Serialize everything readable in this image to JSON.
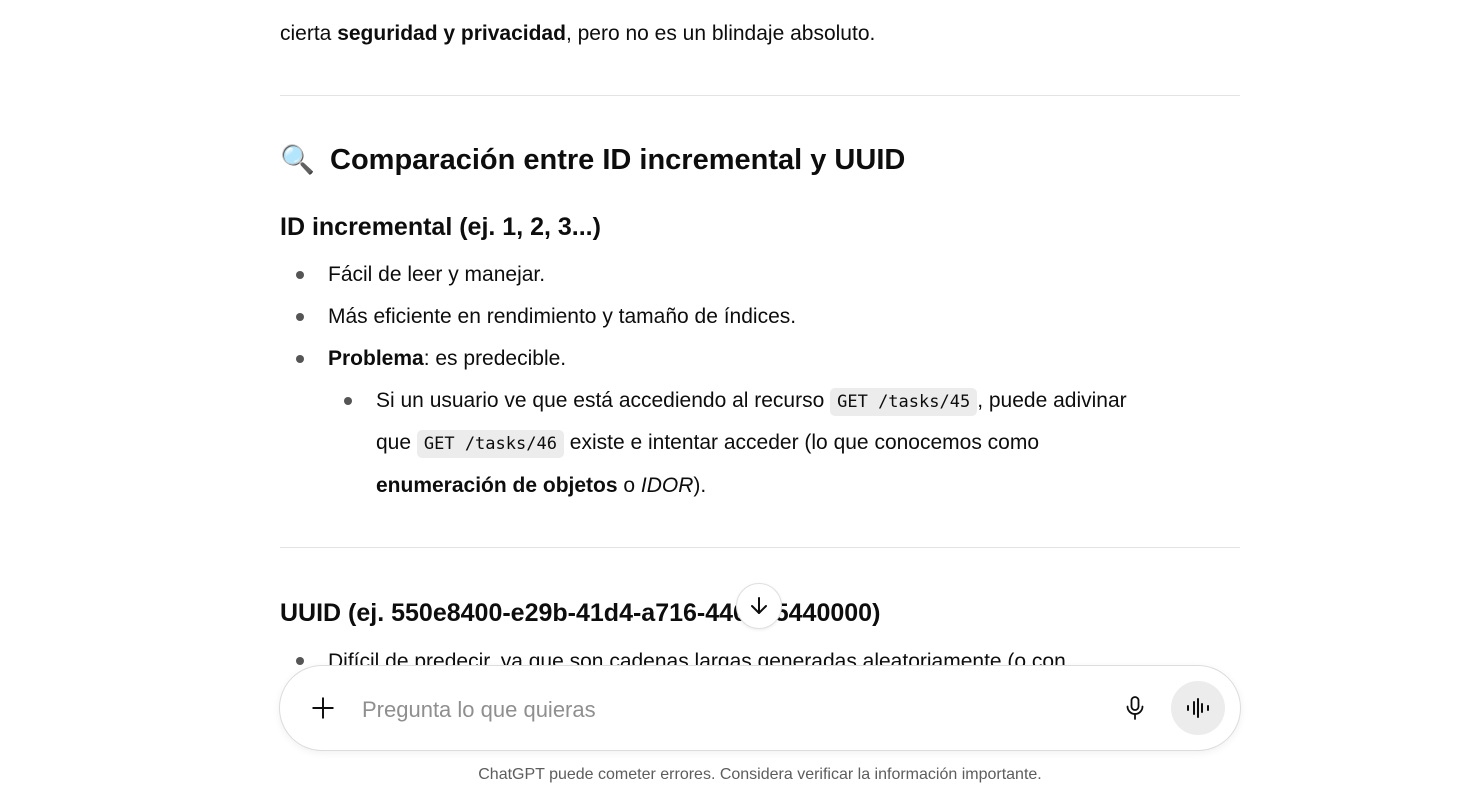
{
  "conversation": {
    "top_paragraph": {
      "prefix": "cierta ",
      "bold": "seguridad y privacidad",
      "suffix": ", pero no es un blindaje absoluto."
    },
    "section_heading": {
      "emoji": "🔍",
      "text": "Comparación entre ID incremental y UUID"
    },
    "incremental": {
      "heading": "ID incremental (ej. 1, 2, 3...)",
      "items": [
        "Fácil de leer y manejar.",
        "Más eficiente en rendimiento y tamaño de índices."
      ],
      "problem_label": "Problema",
      "problem_text": ": es predecible.",
      "sub_item": {
        "part1": "Si un usuario ve que está accediendo al recurso ",
        "code1": "GET /tasks/45",
        "part2": ", puede adivinar",
        "part3": "que ",
        "code2": "GET /tasks/46",
        "part4": " existe e intentar acceder (lo que conocemos como",
        "bold": "enumeración de objetos",
        "part5": " o ",
        "italic": "IDOR",
        "part6": ")."
      }
    },
    "uuid": {
      "heading": "UUID (ej. 550e8400-e29b-41d4-a716-446655440000)",
      "first_item_partial": "Difícil de predecir, ya que son cadenas largas generadas aleatoriamente (o con"
    }
  },
  "composer": {
    "placeholder": "Pregunta lo que quieras"
  },
  "footer": {
    "disclaimer": "ChatGPT puede cometer errores. Considera verificar la información importante."
  },
  "icons": {
    "plus": "plus-icon",
    "mic": "microphone-icon",
    "voice": "voice-mode-icon",
    "scroll": "arrow-down-icon",
    "heading_emoji": "magnifying-glass-icon"
  }
}
